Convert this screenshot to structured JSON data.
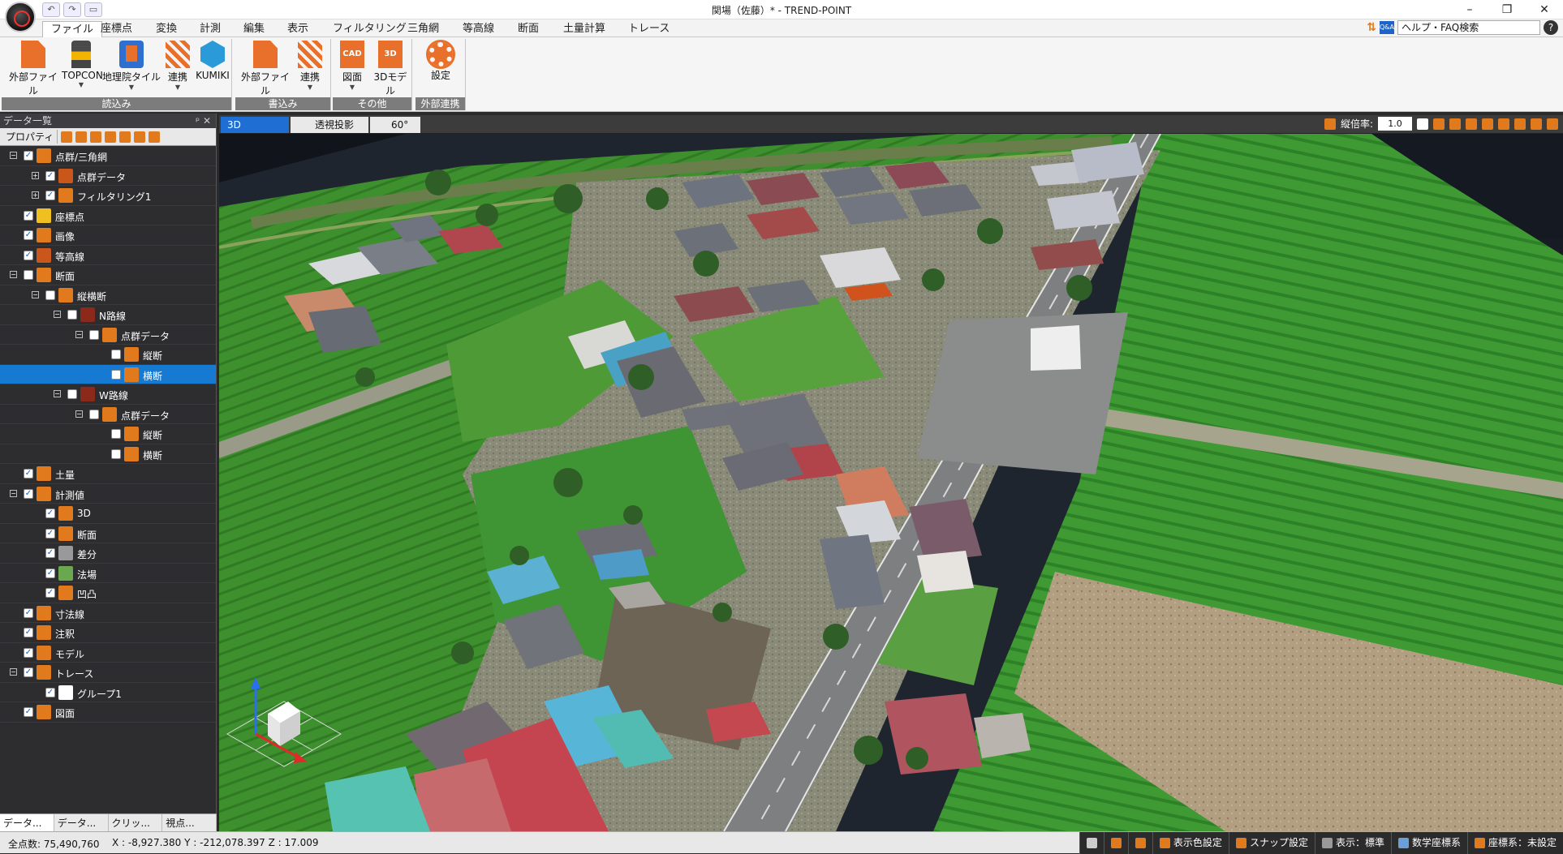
{
  "window": {
    "title": "関場（佐藤）* - TREND-POINT",
    "controls": [
      "–",
      "❐",
      "✕"
    ]
  },
  "menu": {
    "tabs": [
      "ファイル",
      "座標点",
      "変換",
      "計測",
      "編集",
      "表示",
      "フィルタリング",
      "三角網",
      "等高線",
      "断面",
      "土量計算",
      "トレース"
    ],
    "help_search_value": "ヘルプ・FAQ検索",
    "qa_label": "Q&A",
    "help_label": "?"
  },
  "ribbon": {
    "groups": [
      {
        "label": "読込み",
        "buttons": [
          "外部ファイル",
          "TOPCON",
          "地理院タイル",
          "連携",
          "KUMIKI"
        ]
      },
      {
        "label": "書込み",
        "buttons": [
          "外部ファイル",
          "連携"
        ]
      },
      {
        "label": "その他",
        "buttons": [
          "図面",
          "3Dモデル"
        ]
      },
      {
        "label": "外部連携",
        "buttons": [
          "設定"
        ]
      }
    ],
    "icon_texts": {
      "cad": "CAD",
      "model3d": "3D"
    }
  },
  "panel": {
    "title": "データ一覧",
    "pin": "ᵖ ✕",
    "properties_label": "プロパティ",
    "tree": [
      {
        "label": "点群/三角網",
        "level": 0,
        "toggle": "−",
        "checked": true,
        "icon": "pointcloud-icon",
        "color": "#e07a1c"
      },
      {
        "label": "点群データ",
        "level": 1,
        "toggle": "+",
        "checked": true,
        "icon": "pointcloud-data-icon",
        "color": "#c9561a"
      },
      {
        "label": "フィルタリング1",
        "level": 1,
        "toggle": "+",
        "checked": true,
        "icon": "filter-icon",
        "color": "#e07a1c"
      },
      {
        "label": "座標点",
        "level": 0,
        "toggle": "",
        "checked": true,
        "icon": "coordinate-point-icon",
        "color": "#f0c020"
      },
      {
        "label": "画像",
        "level": 0,
        "toggle": "",
        "checked": true,
        "icon": "image-icon",
        "color": "#e07a1c"
      },
      {
        "label": "等高線",
        "level": 0,
        "toggle": "",
        "checked": true,
        "icon": "contour-icon",
        "color": "#c9561a"
      },
      {
        "label": "断面",
        "level": 0,
        "toggle": "−",
        "checked": false,
        "icon": "section-icon",
        "color": "#e07a1c"
      },
      {
        "label": "縦横断",
        "level": 1,
        "toggle": "−",
        "checked": false,
        "icon": "profile-icon",
        "color": "#e07a1c"
      },
      {
        "label": "N路線",
        "level": 2,
        "toggle": "−",
        "checked": false,
        "icon": "route-icon",
        "color": "#8b2a1a"
      },
      {
        "label": "点群データ",
        "level": 3,
        "toggle": "−",
        "checked": false,
        "icon": "route-pointcloud-icon",
        "color": "#e07a1c"
      },
      {
        "label": "縦断",
        "level": 4,
        "toggle": "",
        "checked": false,
        "icon": "longitudinal-icon",
        "color": "#e07a1c"
      },
      {
        "label": "横断",
        "level": 4,
        "toggle": "",
        "checked": false,
        "icon": "cross-section-icon",
        "color": "#e07a1c",
        "selected": true
      },
      {
        "label": "W路線",
        "level": 2,
        "toggle": "−",
        "checked": false,
        "icon": "route-icon",
        "color": "#8b2a1a"
      },
      {
        "label": "点群データ",
        "level": 3,
        "toggle": "−",
        "checked": false,
        "icon": "route-pointcloud-icon",
        "color": "#e07a1c"
      },
      {
        "label": "縦断",
        "level": 4,
        "toggle": "",
        "checked": false,
        "icon": "longitudinal-icon",
        "color": "#e07a1c"
      },
      {
        "label": "横断",
        "level": 4,
        "toggle": "",
        "checked": false,
        "icon": "cross-section-icon",
        "color": "#e07a1c"
      },
      {
        "label": "土量",
        "level": 0,
        "toggle": "",
        "checked": true,
        "icon": "volume-icon",
        "color": "#e07a1c"
      },
      {
        "label": "計測値",
        "level": 0,
        "toggle": "−",
        "checked": true,
        "icon": "measure-icon",
        "color": "#e07a1c"
      },
      {
        "label": "3D",
        "level": 1,
        "toggle": "",
        "checked": true,
        "icon": "measure-3d-icon",
        "color": "#e07a1c"
      },
      {
        "label": "断面",
        "level": 1,
        "toggle": "",
        "checked": true,
        "icon": "measure-section-icon",
        "color": "#e07a1c"
      },
      {
        "label": "差分",
        "level": 1,
        "toggle": "",
        "checked": true,
        "icon": "difference-icon",
        "color": "#999999"
      },
      {
        "label": "法場",
        "level": 1,
        "toggle": "",
        "checked": true,
        "icon": "slope-icon",
        "color": "#6aa84f"
      },
      {
        "label": "凹凸",
        "level": 1,
        "toggle": "",
        "checked": true,
        "icon": "unevenness-icon",
        "color": "#e07a1c"
      },
      {
        "label": "寸法線",
        "level": 0,
        "toggle": "",
        "checked": true,
        "icon": "dimension-icon",
        "color": "#e07a1c"
      },
      {
        "label": "注釈",
        "level": 0,
        "toggle": "",
        "checked": true,
        "icon": "annotation-icon",
        "color": "#e07a1c"
      },
      {
        "label": "モデル",
        "level": 0,
        "toggle": "",
        "checked": true,
        "icon": "model-icon",
        "color": "#e07a1c"
      },
      {
        "label": "トレース",
        "level": 0,
        "toggle": "−",
        "checked": true,
        "icon": "trace-icon",
        "color": "#e07a1c"
      },
      {
        "label": "グループ1",
        "level": 1,
        "toggle": "",
        "checked": true,
        "icon": "warning-icon",
        "color": "#ffffff"
      },
      {
        "label": "図面",
        "level": 0,
        "toggle": "",
        "checked": true,
        "icon": "drawing-icon",
        "color": "#e07a1c"
      }
    ],
    "bottom_tabs": [
      "データ...",
      "データ...",
      "クリッ...",
      "視点..."
    ]
  },
  "view": {
    "tabs": [
      "3D",
      "透視投影",
      "60°"
    ],
    "zoom_label": "縦倍率:",
    "zoom_value": "1.0"
  },
  "status": {
    "point_count": "全点数: 75,490,760",
    "coords": "X : -8,927.380  Y : -212,078.397  Z : 17.009",
    "right_items": [
      "",
      "",
      "",
      "表示色設定",
      "スナップ設定",
      "表示：標準",
      "数学座標系",
      "座標系：未設定"
    ]
  },
  "colors": {
    "accent": "#1f6ed4",
    "orange": "#e07a1c",
    "field_green": "#3f8a2a",
    "road_gray": "#7d7f80"
  }
}
